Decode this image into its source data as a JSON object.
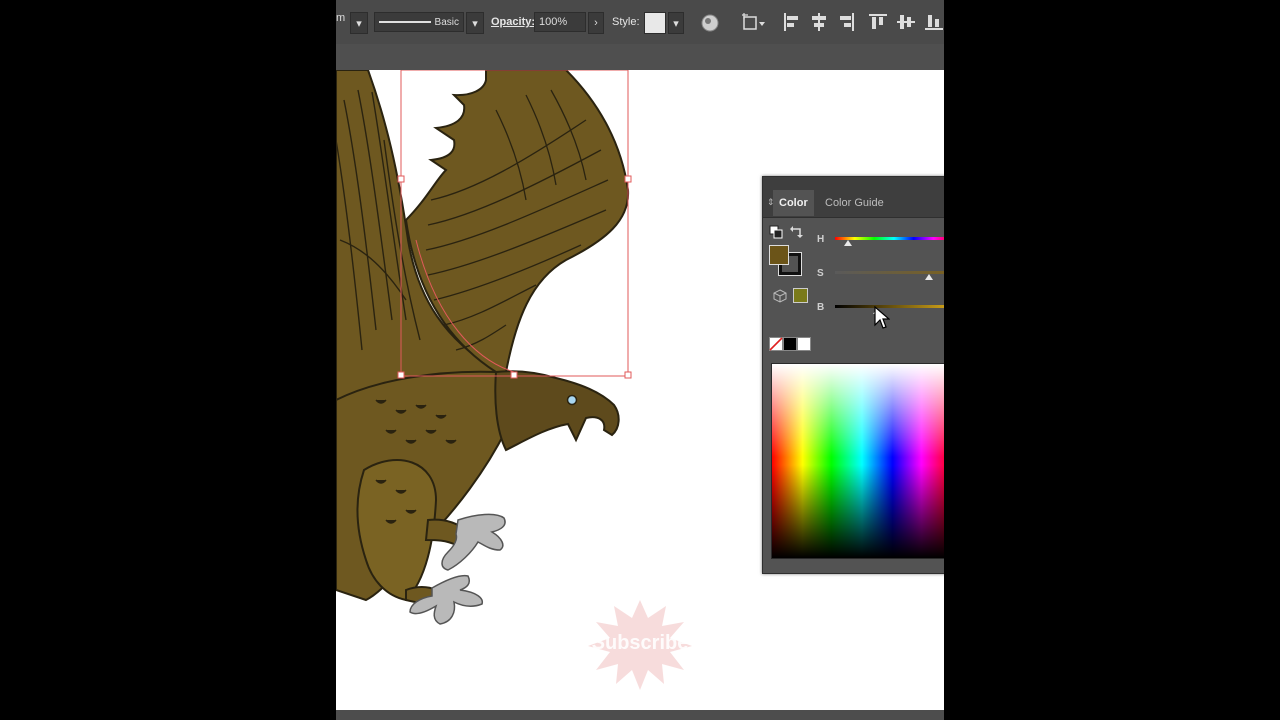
{
  "control_bar": {
    "doc_fragment": "m",
    "brush_label": "Basic",
    "opacity_label": "Opacity:",
    "opacity_value": "100%",
    "style_label": "Style:"
  },
  "color_panel": {
    "tabs": [
      {
        "label": "Color",
        "active": true
      },
      {
        "label": "Color Guide",
        "active": false
      }
    ],
    "fill_color": "#6b5418",
    "out_of_gamut_color": "#7a7a1a",
    "sliders": [
      {
        "label": "H",
        "value": 0.11
      },
      {
        "label": "S",
        "value": 0.8
      },
      {
        "label": "B",
        "value": 0.36
      }
    ]
  },
  "artwork": {
    "watermark_text": "Subscribe",
    "colors": {
      "plumage": "#6e5820",
      "plumage_light": "#7a6323",
      "head": "#5e4a1c",
      "talons": "#b9b9b9",
      "selection": "#e05a5a"
    }
  }
}
